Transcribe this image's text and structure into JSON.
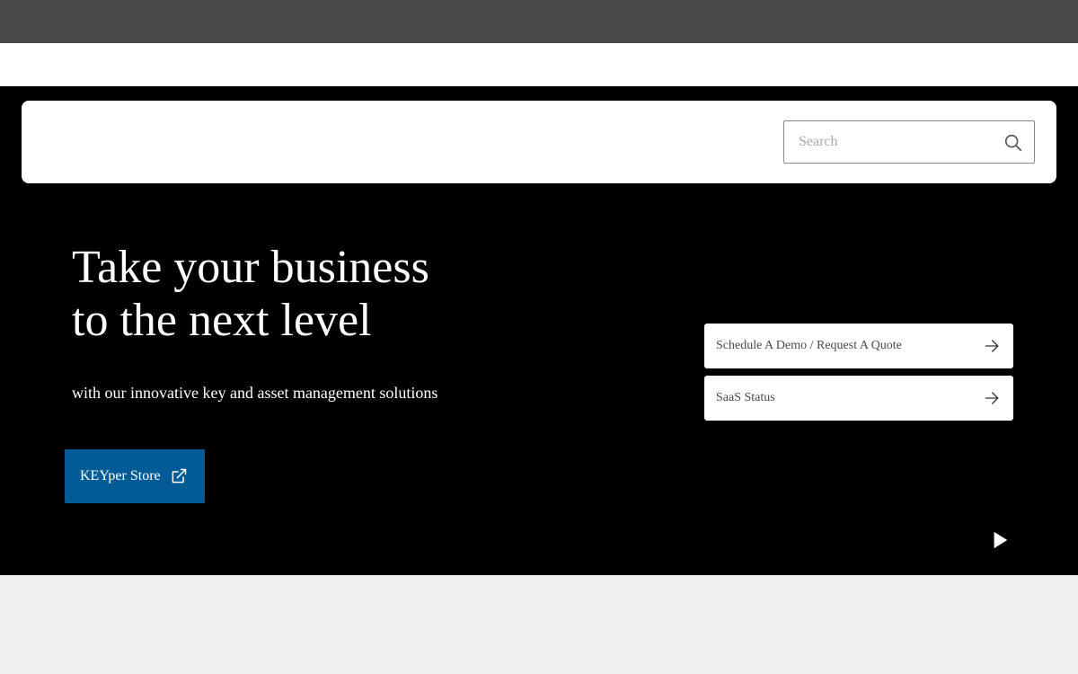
{
  "header": {
    "search_placeholder": "Search",
    "search_value": ""
  },
  "hero": {
    "title_line1": "Take your business",
    "title_line2": "to the next level",
    "subtitle": "with our innovative key and asset management solutions",
    "store_button_label": "KEYper Store",
    "links": [
      {
        "label": "Schedule A Demo / Request A Quote",
        "icon": "arrow-right-icon"
      },
      {
        "label": "SaaS Status",
        "icon": "arrow-right-icon"
      }
    ],
    "media_control_icon": "play-icon"
  },
  "colors": {
    "top_bar": "#4a4a4a",
    "hero_background": "#000000",
    "accent_button": "#005b96",
    "page_background": "#efefef"
  }
}
